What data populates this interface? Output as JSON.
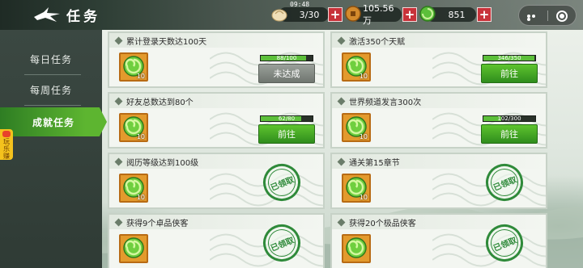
{
  "header": {
    "title": "任务",
    "clock": "09:48",
    "resources": [
      {
        "name": "stamina",
        "icon": "bun-icon",
        "value": "3/30"
      },
      {
        "name": "coins",
        "icon": "copper-coin-icon",
        "value": "105.56万"
      },
      {
        "name": "jade",
        "icon": "jade-icon",
        "value": "851"
      }
    ]
  },
  "sidebar": {
    "tabs": [
      {
        "label": "每日任务",
        "active": false
      },
      {
        "label": "每周任务",
        "active": false
      },
      {
        "label": "成就任务",
        "active": true
      }
    ],
    "badge": "玩乐赚"
  },
  "quests": [
    {
      "title": "累计登录天数达100天",
      "reward_count": "10",
      "progress_text": "88/100",
      "progress": 0.88,
      "state": "incomplete",
      "button_label": "未达成"
    },
    {
      "title": "激活350个天赋",
      "reward_count": "10",
      "progress_text": "346/350",
      "progress": 0.989,
      "state": "go",
      "button_label": "前往"
    },
    {
      "title": "好友总数达到80个",
      "reward_count": "10",
      "progress_text": "62/80",
      "progress": 0.775,
      "state": "go",
      "button_label": "前往"
    },
    {
      "title": "世界频道发言300次",
      "reward_count": "10",
      "progress_text": "102/300",
      "progress": 0.34,
      "state": "go",
      "button_label": "前往"
    },
    {
      "title": "阅历等级达到100级",
      "reward_count": "10",
      "progress_text": "",
      "progress": 1,
      "state": "claimed",
      "button_label": "已领取"
    },
    {
      "title": "通关第15章节",
      "reward_count": "10",
      "progress_text": "",
      "progress": 1,
      "state": "claimed",
      "button_label": "已领取"
    },
    {
      "title": "获得9个卓品侠客",
      "reward_count": "",
      "progress_text": "",
      "progress": 1,
      "state": "claimed",
      "button_label": "已领取"
    },
    {
      "title": "获得20个极品侠客",
      "reward_count": "",
      "progress_text": "",
      "progress": 1,
      "state": "claimed",
      "button_label": "已领取"
    }
  ],
  "colors": {
    "accent_green": "#4fae2b",
    "plus_red": "#c8323a",
    "reward_bg": "#e39a2d"
  }
}
